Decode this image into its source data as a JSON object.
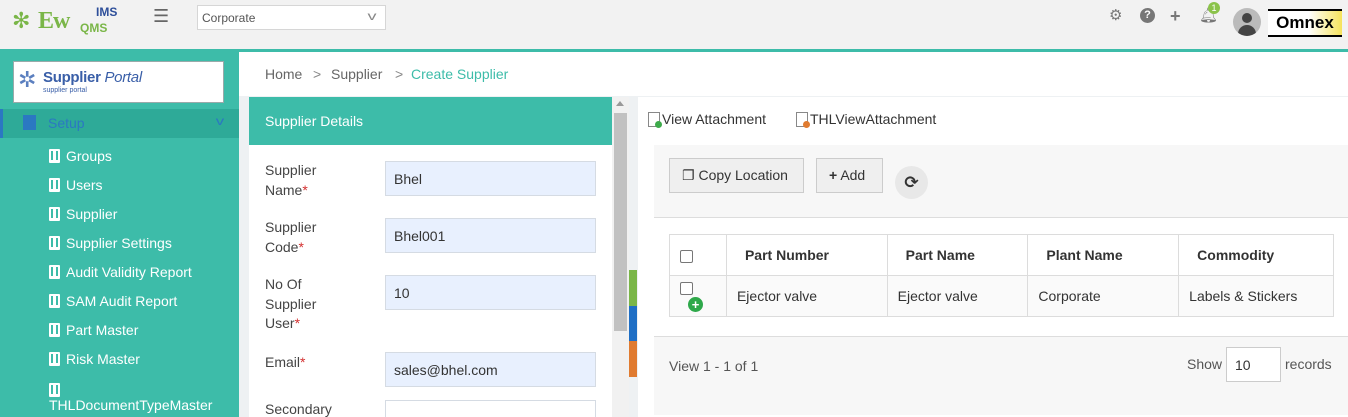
{
  "header": {
    "logo_ew": "Ew",
    "logo_ims": "IMS",
    "logo_qms": "QMS",
    "plant_selected": "Corporate",
    "notification_count": "1",
    "brand": "Omnex"
  },
  "sidebar": {
    "portal_title_bold": "Supplier",
    "portal_title_italic": " Portal",
    "portal_sub": "supplier portal",
    "section_label": "Setup",
    "items": [
      {
        "label": "Groups"
      },
      {
        "label": "Users"
      },
      {
        "label": "Supplier"
      },
      {
        "label": "Supplier Settings"
      },
      {
        "label": "Audit Validity Report"
      },
      {
        "label": "SAM Audit Report"
      },
      {
        "label": "Part Master"
      },
      {
        "label": "Risk Master"
      },
      {
        "label": "THLDocumentTypeMaster"
      }
    ]
  },
  "breadcrumb": {
    "home": "Home",
    "supplier": "Supplier",
    "current": "Create Supplier",
    "separator": ">"
  },
  "details": {
    "title": "Supplier Details",
    "required_mark": "*",
    "fields": {
      "name": {
        "label1": "Supplier",
        "label2": "Name",
        "value": "Bhel"
      },
      "code": {
        "label1": "Supplier",
        "label2": "Code",
        "value": "Bhel001"
      },
      "users": {
        "label1": "No Of",
        "label2": "Supplier",
        "label3": "User",
        "value": "10"
      },
      "email": {
        "label1": "Email",
        "value": "sales@bhel.com"
      },
      "secondary": {
        "label1": "Secondary",
        "value": ""
      }
    }
  },
  "attachments": {
    "view": "View Attachment",
    "thl_view": "THLViewAttachment"
  },
  "toolbar": {
    "copy_location": "Copy Location",
    "add": "Add"
  },
  "table": {
    "columns": [
      "Part Number",
      "Part Name",
      "Plant Name",
      "Commodity"
    ],
    "rows": [
      {
        "part_number": "Ejector valve",
        "part_name": "Ejector valve",
        "plant_name": "Corporate",
        "commodity": "Labels & Stickers"
      }
    ]
  },
  "pager": {
    "summary": "View 1 - 1 of 1",
    "show_label": "Show",
    "records_value": "10",
    "records_label": "records"
  },
  "colors": {
    "accent": "#3dbca9",
    "link_blue": "#2b78c2",
    "required_red": "#d32f2f",
    "strip": [
      "#7ab648",
      "#1f6fc5",
      "#e07b30"
    ]
  }
}
